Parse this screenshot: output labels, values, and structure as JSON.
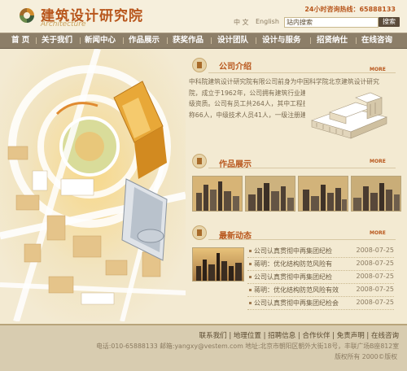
{
  "header": {
    "logo_cn": "建筑设计研究院",
    "logo_en": "Architecture",
    "hotline": "24小时咨询热线：65888133",
    "lang_zh": "中 文",
    "lang_en": "English",
    "search_value": "站内搜索",
    "search_button": "搜索"
  },
  "nav": {
    "items": [
      "首 页",
      "关于我们",
      "新闻中心",
      "作品展示",
      "获奖作品",
      "设计团队",
      "设计与服务",
      "招贤纳仕",
      "在线咨询"
    ]
  },
  "intro": {
    "title": "公司介绍",
    "more": "MORE",
    "text": "中科院建筑设计研究院有限公司前身为中国科学院北京建筑设计研究院，成立于1962年，公司拥有建筑行业建筑工程甲级、市政公用行业甲级资质。公司有员工共264人，其中工程技术人员198人（高级以上职称66人，中级技术人员41人，一级注册建筑师25人，一级注册..."
  },
  "works": {
    "title": "作品展示",
    "more": "MORE"
  },
  "news": {
    "title": "最新动态",
    "more": "MORE",
    "items": [
      {
        "title": "公司认真贯彻中再集团纪检",
        "date": "2008-07-25"
      },
      {
        "title": "蒋明：优化结构防范风险有",
        "date": "2008-07-25"
      },
      {
        "title": "公司认真贯彻中再集团纪检",
        "date": "2008-07-25"
      },
      {
        "title": "蒋明：优化结构防范风险有效",
        "date": "2008-07-25"
      },
      {
        "title": "公司认真贯彻中再集团纪检会",
        "date": "2008-07-25"
      }
    ]
  },
  "footer": {
    "links": "联系我们 | 地理位置 | 招聘信息 | 合作伙伴 | 免责声明 | 在线咨询",
    "contact": "电话:010-65888133 邮箱:yangxy@vestem.com 地址:北京市朝阳区朝外大街18号，丰联广场B座812室",
    "copyright": "版权所有 2000©版权"
  },
  "colors": {
    "accent": "#b8561c",
    "nav_bg": "#8c7e68",
    "page_bg": "#f3ead2"
  }
}
